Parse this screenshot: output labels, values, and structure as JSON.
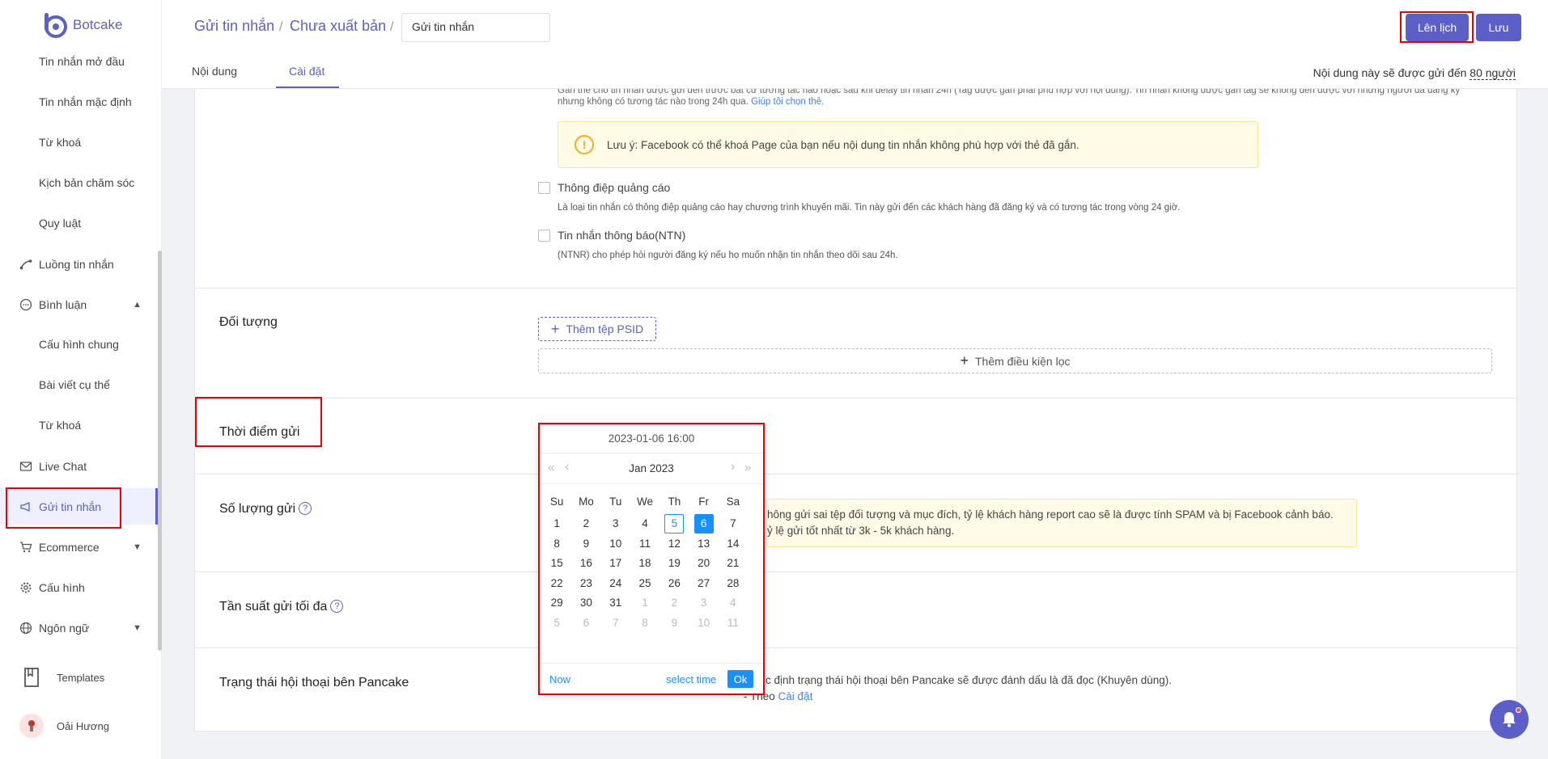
{
  "app": {
    "name": "Botcake"
  },
  "sidebar": {
    "items": [
      {
        "label": "Tin nhắn mở đầu"
      },
      {
        "label": "Tin nhắn mặc định"
      },
      {
        "label": "Từ khoá"
      },
      {
        "label": "Kịch bản chăm sóc"
      },
      {
        "label": "Quy luật"
      },
      {
        "label": "Luồng tin nhắn"
      },
      {
        "label": "Bình luận"
      },
      {
        "label": "Cấu hình chung"
      },
      {
        "label": "Bài viết cụ thể"
      },
      {
        "label": "Từ khoá"
      },
      {
        "label": "Live Chat"
      },
      {
        "label": "Gửi tin nhắn"
      },
      {
        "label": "Ecommerce"
      },
      {
        "label": "Cấu hình"
      },
      {
        "label": "Ngôn ngữ"
      },
      {
        "label": "Templates"
      },
      {
        "label": "Oải Hương"
      }
    ]
  },
  "header": {
    "breadcrumb": [
      "Gửi tin nhắn",
      "Chưa xuất bản"
    ],
    "name_value": "Gửi tin nhắn",
    "tabs": [
      "Nội dung",
      "Cài đặt"
    ],
    "schedule_label": "Lên lịch",
    "save_label": "Lưu",
    "audience_text": "Nội dung này sẽ được gửi đến",
    "audience_count": "80 người"
  },
  "content": {
    "top_text": "Gắn thẻ cho tin nhắn được gửi đến trước bất cứ tương tác nào hoặc sau khi delay tin nhắn 24h (Tag được gắn phải phù hợp với nội dung). Tin nhắn không được gắn tag sẽ không đến được với những người đã đăng ký",
    "top_text2": "nhưng không có tương tác nào trong 24h qua.",
    "help_link": "Giúp tôi chọn thẻ.",
    "fb_warning": "Lưu ý: Facebook có thể khoá Page của bạn nếu nội dung tin nhắn không phù hợp với thẻ đã gắn.",
    "option1_label": "Thông điệp quảng cáo",
    "option1_desc": "Là loại tin nhắn có thông điệp quảng cáo hay chương trình khuyến mãi. Tin này gửi đến các khách hàng đã đăng ký và có tương tác trong vòng 24 giờ.",
    "option2_label": "Tin nhắn thông báo(NTN)",
    "option2_desc": "(NTNR) cho phép hỏi người đăng ký nếu họ muốn nhận tin nhắn theo dõi sau 24h.",
    "audience_title": "Đối tượng",
    "add_psid": "Thêm tệp PSID",
    "add_filter": "Thêm điều kiện lọc",
    "send_time_title": "Thời điểm gửi",
    "send_count_title": "Số lượng gửi",
    "send_count_warn1": "hông gửi sai tệp đối tượng và mục đích, tỷ lệ khách hàng report cao sẽ là được tính SPAM và bị Facebook cảnh báo.",
    "send_count_warn2": "ỷ lệ gửi tốt nhất từ 3k - 5k khách hàng.",
    "freq_title": "Tần suất gửi tối đa",
    "status_title": "Trạng thái hội thoại bên Pancake",
    "status_text": "c định trạng thái hội thoại bên Pancake sẽ được đánh dấu là đã đọc (Khuyên dùng).",
    "status_text2_prefix": "- Theo",
    "status_link": "Cài đặt"
  },
  "datepicker": {
    "value": "2023-01-06 16:00",
    "month_label": "Jan 2023",
    "prev_year": "«",
    "prev_month": "‹",
    "next_month": "›",
    "next_year": "»",
    "weekdays": [
      "Su",
      "Mo",
      "Tu",
      "We",
      "Th",
      "Fr",
      "Sa"
    ],
    "weeks": [
      [
        "1",
        "2",
        "3",
        "4",
        "5",
        "6",
        "7"
      ],
      [
        "8",
        "9",
        "10",
        "11",
        "12",
        "13",
        "14"
      ],
      [
        "15",
        "16",
        "17",
        "18",
        "19",
        "20",
        "21"
      ],
      [
        "22",
        "23",
        "24",
        "25",
        "26",
        "27",
        "28"
      ],
      [
        "29",
        "30",
        "31",
        "1",
        "2",
        "3",
        "4"
      ],
      [
        "5",
        "6",
        "7",
        "8",
        "9",
        "10",
        "11"
      ]
    ],
    "today": "5",
    "selected": "6",
    "now_label": "Now",
    "select_time_label": "select time",
    "ok_label": "Ok"
  },
  "colors": {
    "accent": "#5b5fc7",
    "picker_blue": "#1890ff",
    "highlight_red": "#e00000"
  }
}
